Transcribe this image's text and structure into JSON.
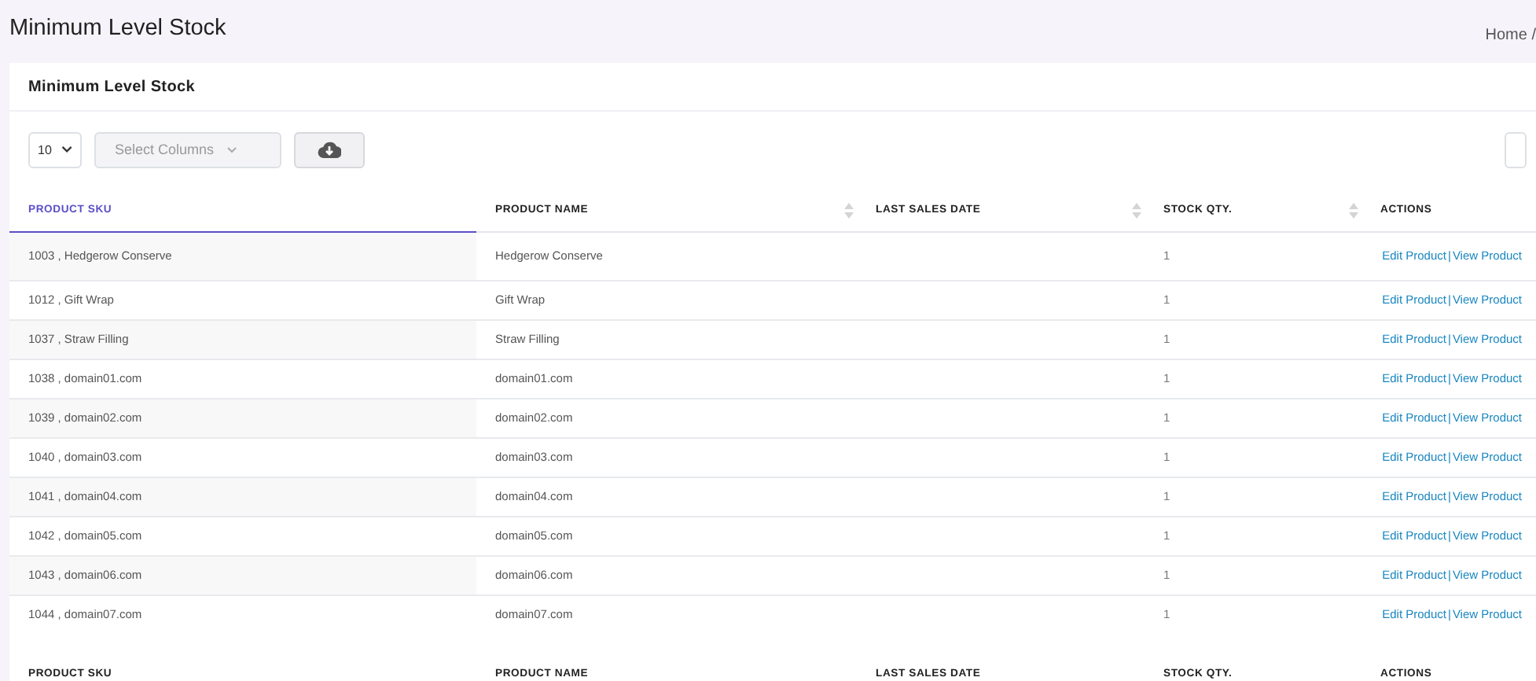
{
  "page_title": "Minimum Level Stock",
  "breadcrumb": "Home /",
  "card": {
    "title": "Minimum Level Stock"
  },
  "toolbar": {
    "page_size": "10",
    "columns_select": {
      "placeholder": "Select Columns"
    }
  },
  "table": {
    "columns": [
      {
        "label": "PRODUCT SKU",
        "selected": true,
        "sort_icon": false
      },
      {
        "label": "PRODUCT NAME",
        "selected": false,
        "sort_icon": true
      },
      {
        "label": "LAST SALES DATE",
        "selected": false,
        "sort_icon": true
      },
      {
        "label": "STOCK QTY.",
        "selected": false,
        "sort_icon": true
      },
      {
        "label": "ACTIONS",
        "selected": false,
        "sort_icon": false
      }
    ],
    "rows": [
      {
        "sku": "1003 , Hedgerow Conserve",
        "name": "Hedgerow Conserve",
        "qty": "1",
        "edit": "Edit Product",
        "sep": "|",
        "view": "View Product"
      },
      {
        "sku": "1012 , Gift Wrap",
        "name": "Gift Wrap",
        "qty": "1",
        "edit": "Edit Product",
        "sep": "|",
        "view": "View Product"
      },
      {
        "sku": "1037 , Straw Filling",
        "name": "Straw Filling",
        "qty": "1",
        "edit": "Edit Product",
        "sep": "|",
        "view": "View Product"
      },
      {
        "sku": "1038 , domain01.com",
        "name": "domain01.com",
        "qty": "1",
        "edit": "Edit Product",
        "sep": "|",
        "view": "View Product"
      },
      {
        "sku": "1039 , domain02.com",
        "name": "domain02.com",
        "qty": "1",
        "edit": "Edit Product",
        "sep": "|",
        "view": "View Product"
      },
      {
        "sku": "1040 , domain03.com",
        "name": "domain03.com",
        "qty": "1",
        "edit": "Edit Product",
        "sep": "|",
        "view": "View Product"
      },
      {
        "sku": "1041 , domain04.com",
        "name": "domain04.com",
        "qty": "1",
        "edit": "Edit Product",
        "sep": "|",
        "view": "View Product"
      },
      {
        "sku": "1042 , domain05.com",
        "name": "domain05.com",
        "qty": "1",
        "edit": "Edit Product",
        "sep": "|",
        "view": "View Product"
      },
      {
        "sku": "1043 , domain06.com",
        "name": "domain06.com",
        "qty": "1",
        "edit": "Edit Product",
        "sep": "|",
        "view": "View Product"
      },
      {
        "sku": "1044 , domain07.com",
        "name": "domain07.com",
        "qty": "1",
        "edit": "Edit Product",
        "sep": "|",
        "view": "View Product"
      }
    ],
    "footer_columns": [
      "PRODUCT SKU",
      "PRODUCT NAME",
      "LAST SALES DATE",
      "STOCK QTY.",
      "ACTIONS"
    ]
  }
}
